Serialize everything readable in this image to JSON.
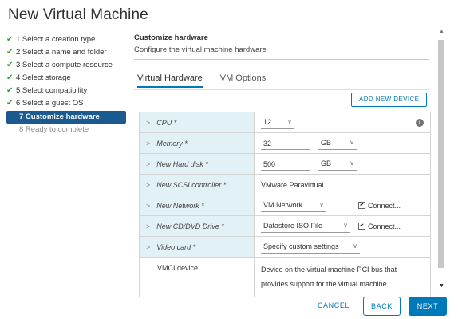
{
  "window": {
    "title": "New Virtual Machine"
  },
  "steps": [
    {
      "label": "1 Select a creation type",
      "state": "done"
    },
    {
      "label": "2 Select a name and folder",
      "state": "done"
    },
    {
      "label": "3 Select a compute resource",
      "state": "done"
    },
    {
      "label": "4 Select storage",
      "state": "done"
    },
    {
      "label": "5 Select compatibility",
      "state": "done"
    },
    {
      "label": "6 Select a guest OS",
      "state": "done"
    },
    {
      "label": "7 Customize hardware",
      "state": "active"
    },
    {
      "label": "8 Ready to complete",
      "state": "pending"
    }
  ],
  "main": {
    "title": "Customize hardware",
    "subtitle": "Configure the virtual machine hardware",
    "tabs": [
      {
        "label": "Virtual Hardware",
        "active": true
      },
      {
        "label": "VM Options",
        "active": false
      }
    ],
    "add_device_label": "ADD NEW DEVICE"
  },
  "hardware": {
    "cpu": {
      "label": "CPU *",
      "value": "12"
    },
    "memory": {
      "label": "Memory *",
      "value": "32",
      "unit": "GB"
    },
    "hard_disk": {
      "label": "New Hard disk *",
      "value": "500",
      "unit": "GB"
    },
    "scsi": {
      "label": "New SCSI controller *",
      "value": "VMware Paravirtual"
    },
    "network": {
      "label": "New Network *",
      "value": "VM Network",
      "connect_label": "Connect..."
    },
    "cd_dvd": {
      "label": "New CD/DVD Drive *",
      "value": "Datastore ISO File",
      "connect_label": "Connect..."
    },
    "video": {
      "label": "Video card *",
      "value": "Specify custom settings"
    },
    "vmci": {
      "label": "VMCI device",
      "line1": "Device on the virtual machine PCI bus that",
      "line2": "provides support for the virtual machine"
    }
  },
  "footer": {
    "cancel": "CANCEL",
    "back": "BACK",
    "next": "NEXT"
  },
  "icons": {
    "check": "checkmark-icon",
    "chevron": "chevron-right-icon",
    "dropdown": "chevron-down-icon",
    "info": "info-icon"
  },
  "colors": {
    "accent": "#0079b8",
    "active_step": "#1b5a8e",
    "check": "#3a9b3a",
    "row_label_bg": "#e1f1f6"
  }
}
